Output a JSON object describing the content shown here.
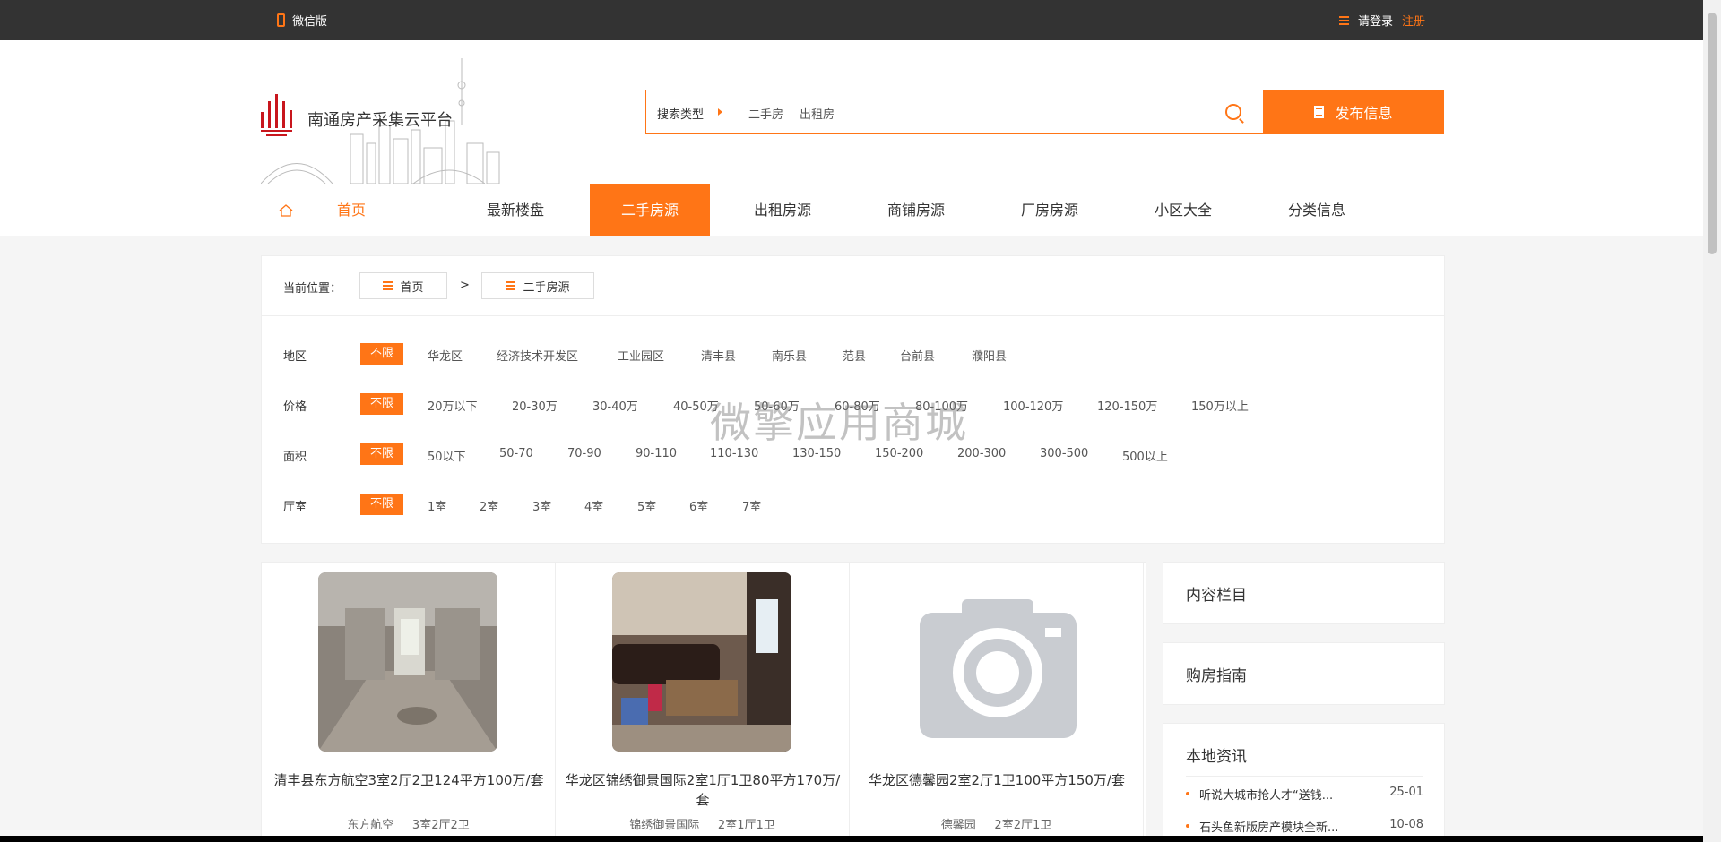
{
  "topbar": {
    "wechat": "微信版",
    "login": "请登录",
    "register": "注册"
  },
  "header": {
    "site_name": "南通房产采集云平台",
    "search_type_label": "搜索类型",
    "search_options": [
      "二手房",
      "出租房"
    ],
    "search_placeholder": "",
    "publish_label": "发布信息"
  },
  "nav": {
    "items": [
      "首页",
      "最新楼盘",
      "二手房源",
      "出租房源",
      "商铺房源",
      "厂房房源",
      "小区大全",
      "分类信息"
    ],
    "active_index": 2
  },
  "breadcrumb": {
    "label": "当前位置：",
    "items": [
      "首页",
      "二手房源"
    ],
    "separator": ">"
  },
  "filters": [
    {
      "label": "地区",
      "selected": "不限",
      "options": [
        "华龙区",
        "经济技术开发区",
        "工业园区",
        "清丰县",
        "南乐县",
        "范县",
        "台前县",
        "濮阳县"
      ]
    },
    {
      "label": "价格",
      "selected": "不限",
      "options": [
        "20万以下",
        "20-30万",
        "30-40万",
        "40-50万",
        "50-60万",
        "60-80万",
        "80-100万",
        "100-120万",
        "120-150万",
        "150万以上"
      ]
    },
    {
      "label": "面积",
      "selected": "不限",
      "options": [
        "50以下",
        "50-70",
        "70-90",
        "90-110",
        "110-130",
        "130-150",
        "150-200",
        "200-300",
        "300-500",
        "500以上"
      ]
    },
    {
      "label": "厅室",
      "selected": "不限",
      "options": [
        "1室",
        "2室",
        "3室",
        "4室",
        "5室",
        "6室",
        "7室"
      ]
    }
  ],
  "listings": [
    {
      "title": "清丰县东方航空3室2厅2卫124平方100万/套",
      "community": "东方航空",
      "layout": "3室2厅2卫"
    },
    {
      "title": "华龙区锦绣御景国际2室1厅1卫80平方170万/套",
      "community": "锦绣御景国际",
      "layout": "2室1厅1卫"
    },
    {
      "title": "华龙区德馨园2室2厅1卫100平方150万/套",
      "community": "德馨园",
      "layout": "2室2厅1卫"
    }
  ],
  "sidebar": {
    "content_column": "内容栏目",
    "buy_guide": "购房指南",
    "local_news": "本地资讯",
    "news": [
      {
        "title": "听说大城市抢人才“送钱...",
        "date": "25-01"
      },
      {
        "title": "石头鱼新版房产模块全新...",
        "date": "10-08"
      }
    ]
  },
  "watermark": "微擎应用商城",
  "colors": {
    "accent": "#ff7516",
    "topbar": "#333333"
  }
}
